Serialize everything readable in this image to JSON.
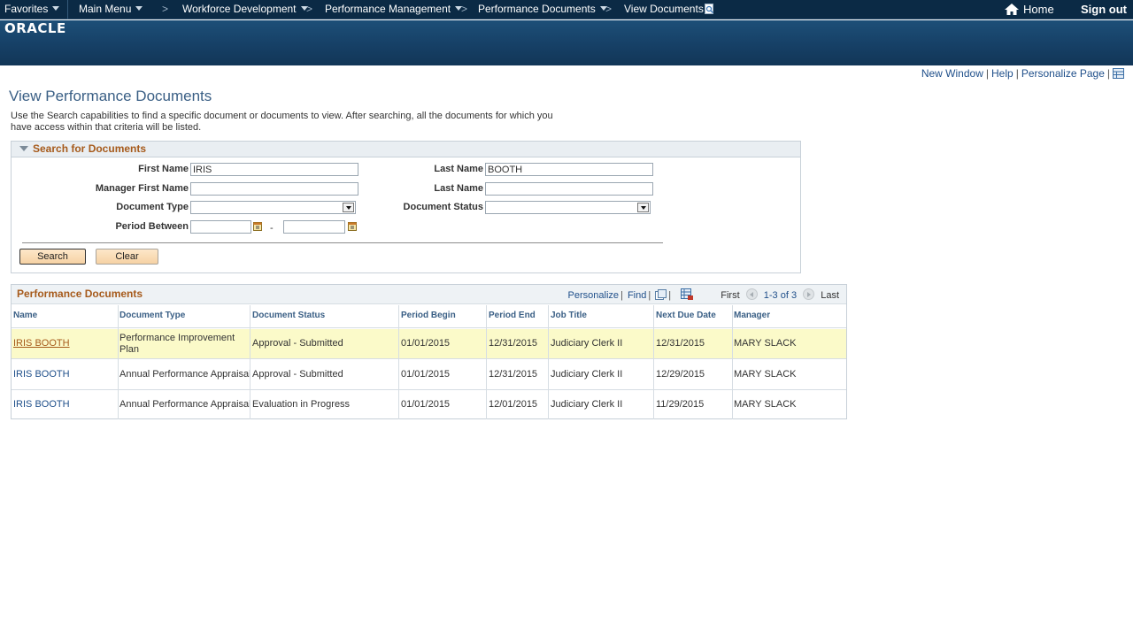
{
  "nav": {
    "favorites": "Favorites",
    "main_menu": "Main Menu",
    "breadcrumbs": [
      "Workforce Development",
      "Performance Management",
      "Performance Documents",
      "View Documents"
    ],
    "separator": ">",
    "home": "Home",
    "sign_out": "Sign out"
  },
  "brand": {
    "logo": "ORACLE"
  },
  "page_links": {
    "new_window": "New Window",
    "help": "Help",
    "personalize_page": "Personalize Page",
    "bar": "|"
  },
  "page": {
    "title": "View Performance Documents",
    "instructions": "Use the Search capabilities to find a specific document or documents to view. After searching, all the documents for which you have access within that criteria will be listed."
  },
  "search": {
    "section_title": "Search for Documents",
    "first_name_label": "First Name",
    "first_name_value": "IRIS",
    "last_name_label": "Last Name",
    "last_name_value": "BOOTH",
    "manager_first_name_label": "Manager First Name",
    "manager_first_name_value": "",
    "manager_last_name_label": "Last Name",
    "manager_last_name_value": "",
    "document_type_label": "Document Type",
    "document_type_value": "",
    "document_status_label": "Document Status",
    "document_status_value": "",
    "period_between_label": "Period Between",
    "period_from_value": "",
    "period_to_value": "",
    "period_dash": "-",
    "search_button": "Search",
    "clear_button": "Clear"
  },
  "results": {
    "title": "Performance Documents",
    "personalize": "Personalize",
    "find": "Find",
    "bar": "|",
    "first": "First",
    "range": "1-3 of 3",
    "last": "Last",
    "columns": [
      "Name",
      "Document Type",
      "Document Status",
      "Period Begin",
      "Period End",
      "Job Title",
      "Next Due Date",
      "Manager"
    ],
    "rows": [
      {
        "name": "IRIS BOOTH",
        "document_type": "Performance Improvement Plan",
        "document_status": "Approval - Submitted",
        "period_begin": "01/01/2015",
        "period_end": "12/31/2015",
        "job_title": "Judiciary Clerk II",
        "next_due_date": "12/31/2015",
        "manager": "MARY SLACK"
      },
      {
        "name": "IRIS BOOTH",
        "document_type": "Annual Performance Appraisal",
        "document_status": "Approval - Submitted",
        "period_begin": "01/01/2015",
        "period_end": "12/31/2015",
        "job_title": "Judiciary Clerk II",
        "next_due_date": "12/29/2015",
        "manager": "MARY SLACK"
      },
      {
        "name": "IRIS BOOTH",
        "document_type": "Annual Performance Appraisal",
        "document_status": "Evaluation in Progress",
        "period_begin": "01/01/2015",
        "period_end": "12/01/2015",
        "job_title": "Judiciary Clerk II",
        "next_due_date": "11/29/2015",
        "manager": "MARY SLACK"
      }
    ]
  },
  "colors": {
    "nav_bg": "#0b2a45",
    "banner": "#164066",
    "section_title": "#a65a1b",
    "link": "#1f4f8a",
    "highlight_row": "#fbfac9",
    "button": "#f6d2a4"
  }
}
